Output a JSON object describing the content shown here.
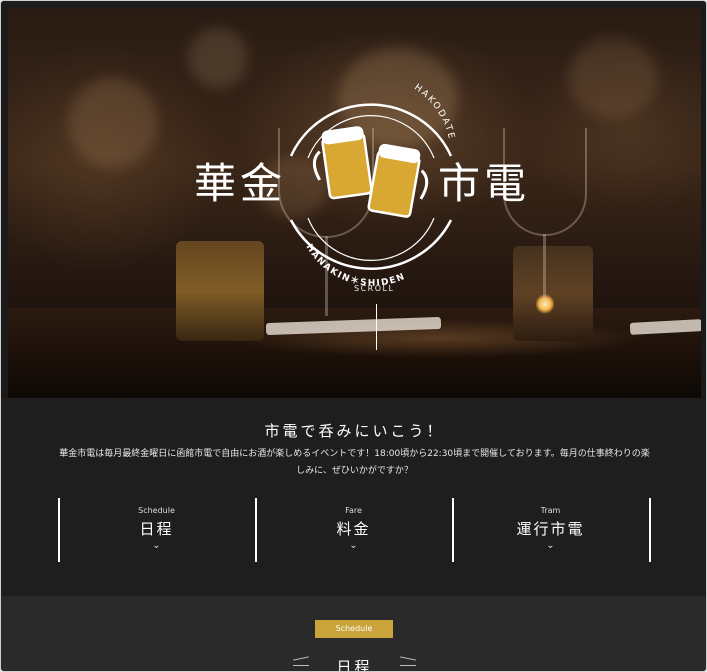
{
  "hero": {
    "logo_arc_top": "HAKODATE",
    "logo_arc_bottom": "HANAKIN＊SHIDEN",
    "logo_left": "華金",
    "logo_right": "市電",
    "scroll_label": "SCROLL"
  },
  "intro": {
    "title": "市電で呑みにいこう！",
    "text": "華金市電は毎月最終金曜日に函館市電で自由にお酒が楽しめるイベントです！18:00頃から22:30頃まで開催しております。毎月の仕事終わりの楽しみに、ぜひいかがですか？"
  },
  "nav": [
    {
      "en": "Schedule",
      "jp": "日程",
      "chevron": "⌄"
    },
    {
      "en": "Fare",
      "jp": "料金",
      "chevron": "⌄"
    },
    {
      "en": "Tram",
      "jp": "運行市電",
      "chevron": "⌄"
    }
  ],
  "schedule": {
    "badge": "Schedule",
    "title": "日程"
  },
  "colors": {
    "accent": "#c9a43a",
    "background": "#1e1e1e",
    "beer": "#d9a832"
  },
  "icons": [
    "beer-mug-icon",
    "chevron-down-icon"
  ]
}
